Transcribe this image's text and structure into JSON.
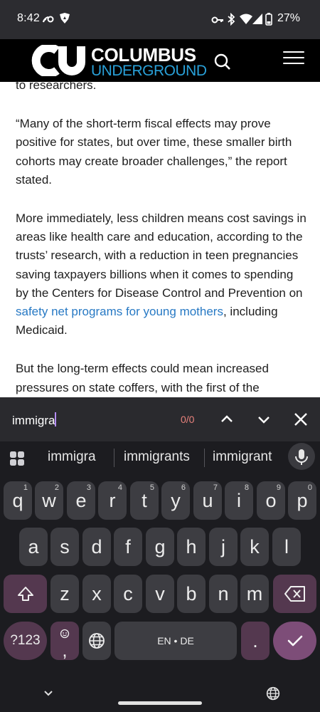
{
  "status_bar": {
    "time": "8:42",
    "battery": "27%",
    "icons": [
      "cast-icon",
      "shield-heart-icon",
      "key-icon",
      "bluetooth-icon",
      "wifi-icon",
      "signal-icon",
      "battery-icon"
    ]
  },
  "site": {
    "logo_line1": "COLUMBUS",
    "logo_line2": "UNDERGROUND",
    "brand_accent": "#29a0d8"
  },
  "article": {
    "p0": "to researchers.",
    "p1": "“Many of the short-term fiscal effects may prove positive for states, but over time, these smaller birth cohorts may create broader challenges,” the report stated.",
    "p2_before": "More immediately, less children means cost savings in areas like health care and education, according to the trusts’ research, with a reduction in teen pregnancies saving taxpayers billions when it comes to spending by the Centers for Disease Control and Prevention on ",
    "p2_link": "safety net programs for young mothers",
    "p2_after": ", including Medicaid.",
    "p3": "But the long-term effects could mean increased pressures on state coffers, with the first of the"
  },
  "find_bar": {
    "query": "immigra",
    "count": "0/0"
  },
  "keyboard": {
    "suggestions": [
      "immigra",
      "immigrants",
      "immigrant"
    ],
    "row1": [
      {
        "k": "q",
        "h": "1"
      },
      {
        "k": "w",
        "h": "2"
      },
      {
        "k": "e",
        "h": "3"
      },
      {
        "k": "r",
        "h": "4"
      },
      {
        "k": "t",
        "h": "5"
      },
      {
        "k": "y",
        "h": "6"
      },
      {
        "k": "u",
        "h": "7"
      },
      {
        "k": "i",
        "h": "8"
      },
      {
        "k": "o",
        "h": "9"
      },
      {
        "k": "p",
        "h": "0"
      }
    ],
    "row2": [
      "a",
      "s",
      "d",
      "f",
      "g",
      "h",
      "j",
      "k",
      "l"
    ],
    "row3": [
      "z",
      "x",
      "c",
      "v",
      "b",
      "n",
      "m"
    ],
    "symbols_label": "?123",
    "comma_label": ",",
    "space_label": "EN • DE",
    "period_label": "."
  }
}
